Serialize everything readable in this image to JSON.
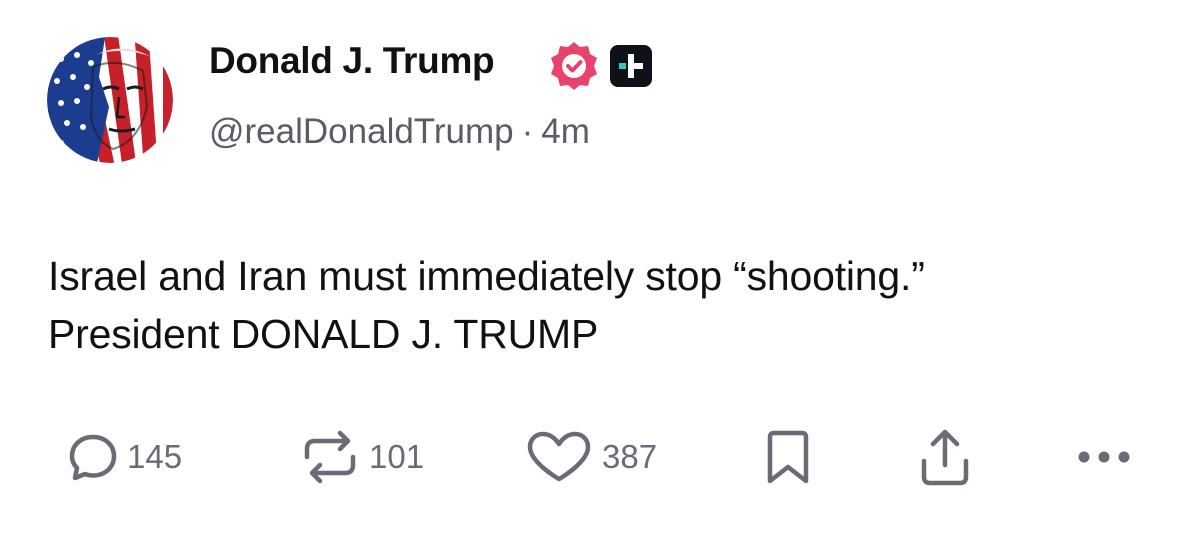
{
  "post": {
    "author": {
      "display_name": "Donald J. Trump",
      "handle": "@realDonaldTrump",
      "separator": "·",
      "time_ago": "4m",
      "avatar_icon": "american-flag-portrait-avatar",
      "verified_icon": "verified-badge-icon",
      "plus_icon": "plus-badge-icon"
    },
    "body_lines": [
      "Israel and Iran must immediately stop “shooting.”",
      "President DONALD J. TRUMP"
    ],
    "actions": {
      "reply": {
        "icon": "reply-icon",
        "count": "145"
      },
      "repost": {
        "icon": "repost-icon",
        "count": "101"
      },
      "like": {
        "icon": "heart-icon",
        "count": "387"
      },
      "bookmark": {
        "icon": "bookmark-icon"
      },
      "share": {
        "icon": "share-icon"
      },
      "more": {
        "icon": "more-options-icon"
      }
    },
    "colors": {
      "verified": "#e8436b",
      "plus_badge": "#0e1117",
      "plus_accent": "#3cc5c5",
      "text": "#111111",
      "muted": "#5b5b66",
      "icon": "#6b6b75"
    }
  }
}
